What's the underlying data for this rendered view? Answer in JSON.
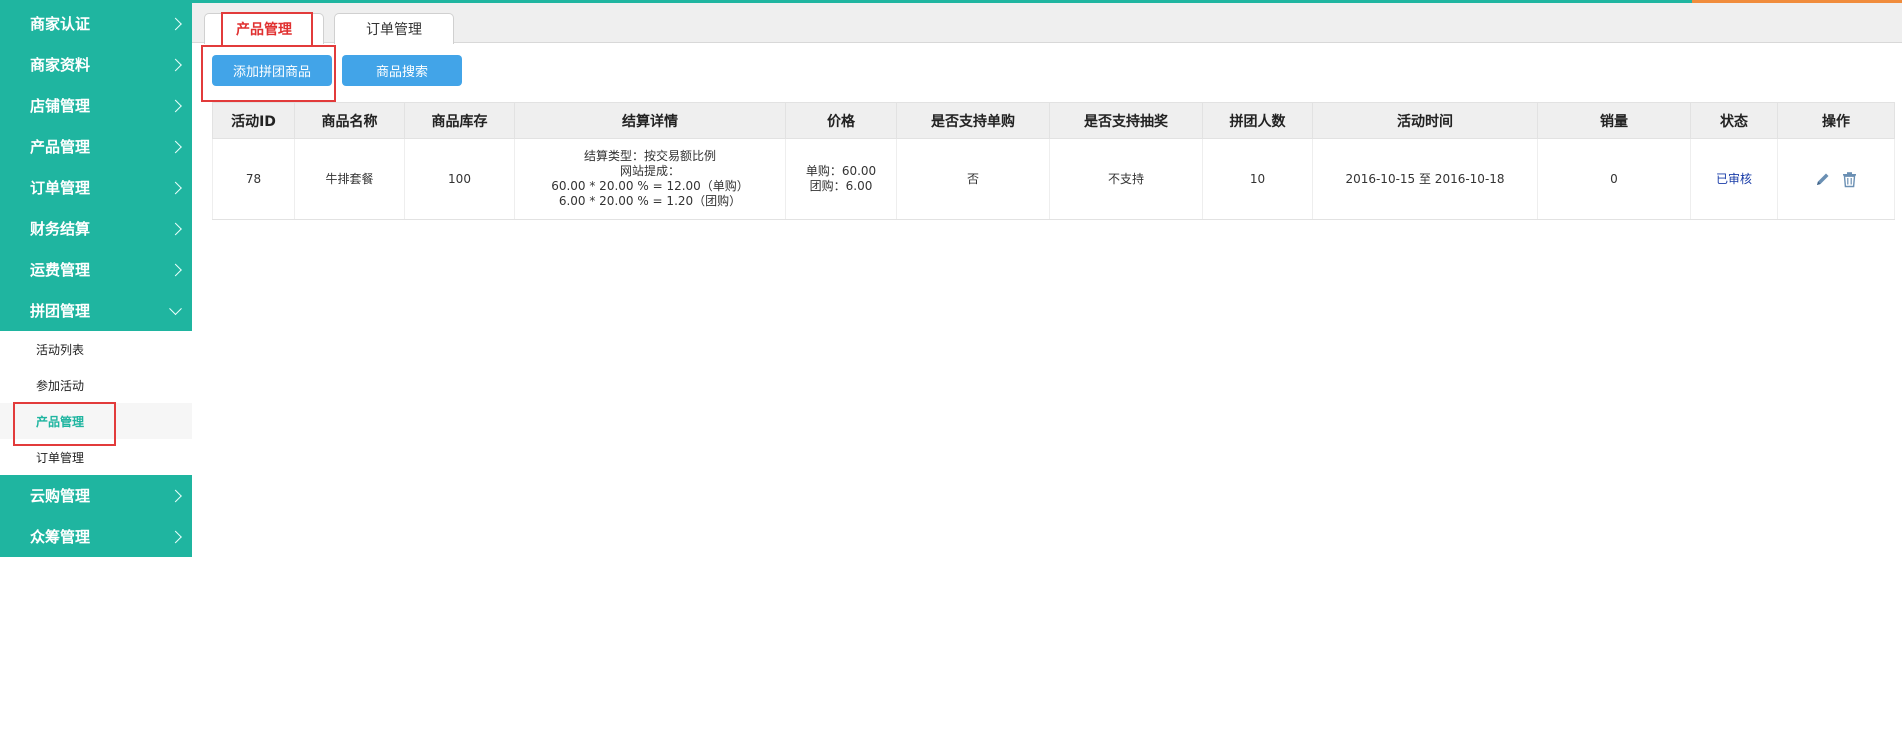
{
  "sidebar": {
    "items_top": [
      {
        "label": "商家认证"
      },
      {
        "label": "商家资料"
      },
      {
        "label": "店铺管理"
      },
      {
        "label": "产品管理"
      },
      {
        "label": "订单管理"
      },
      {
        "label": "财务结算"
      },
      {
        "label": "运费管理"
      },
      {
        "label": "拼团管理"
      }
    ],
    "sub_items": [
      {
        "label": "活动列表"
      },
      {
        "label": "参加活动"
      },
      {
        "label": "产品管理"
      },
      {
        "label": "订单管理"
      }
    ],
    "items_bottom": [
      {
        "label": "云购管理"
      },
      {
        "label": "众筹管理"
      }
    ]
  },
  "tabs": [
    {
      "label": "产品管理"
    },
    {
      "label": "订单管理"
    }
  ],
  "toolbar": {
    "add_label": "添加拼团商品",
    "search_label": "商品搜索"
  },
  "table": {
    "headers": [
      "活动ID",
      "商品名称",
      "商品库存",
      "结算详情",
      "价格",
      "是否支持单购",
      "是否支持抽奖",
      "拼团人数",
      "活动时间",
      "销量",
      "状态",
      "操作"
    ],
    "rows": [
      {
        "id": "78",
        "name": "牛排套餐",
        "stock": "100",
        "settle_1": "结算类型：按交易额比例",
        "settle_2": "网站提成：",
        "settle_3": "60.00 * 20.00 % = 12.00（单购）",
        "settle_4": "6.00 * 20.00 % = 1.20（团购）",
        "price_1": "单购：60.00",
        "price_2": "团购：6.00",
        "single": "否",
        "lottery": "不支持",
        "group_size": "10",
        "time": "2016-10-15 至 2016-10-18",
        "sales": "0",
        "status": "已审核"
      }
    ]
  },
  "icons": {
    "edit": "pencil-icon",
    "delete": "trash-icon"
  },
  "colors": {
    "sidebar": "#1fb5a0",
    "button": "#42a4e8",
    "active_tab": "#e03030",
    "highlight": "#e23b3b"
  }
}
